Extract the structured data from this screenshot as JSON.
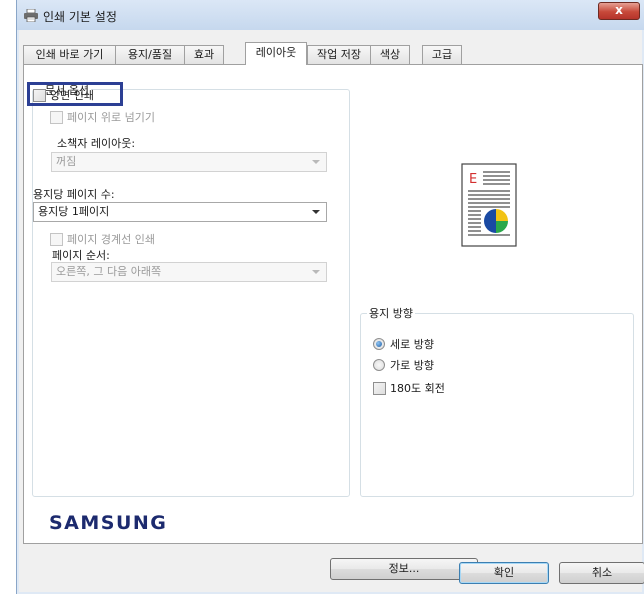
{
  "window": {
    "title": "인쇄 기본 설정",
    "close_label": "x"
  },
  "tabs": [
    {
      "label": "인쇄 바로 가기"
    },
    {
      "label": "용지/품질"
    },
    {
      "label": "효과"
    },
    {
      "label": "레이아웃"
    },
    {
      "label": "작업 저장"
    },
    {
      "label": "색상"
    },
    {
      "label": "고급"
    }
  ],
  "document_options": {
    "legend": "문서 옵션",
    "duplex_label": "양면 인쇄",
    "duplex_checked": false,
    "flip_pages_label": "페이지 위로 넘기기",
    "booklet_label": "소책자 레이아웃:",
    "booklet_value": "꺼짐",
    "pages_per_sheet_label": "용지당 페이지 수:",
    "pages_per_sheet_value": "용지당 1페이지",
    "print_borders_label": "페이지 경계선 인쇄",
    "page_order_label": "페이지 순서:",
    "page_order_value": "오른쪽, 그 다음 아래쪽"
  },
  "orientation": {
    "legend": "용지 방향",
    "portrait_label": "세로 방향",
    "landscape_label": "가로 방향",
    "rotate_label": "180도 회전",
    "selected": "portrait"
  },
  "brand": {
    "logo_text": "SAMSUNG"
  },
  "buttons": {
    "info_label": "정보...",
    "ok_label": "확인",
    "cancel_label": "취소"
  },
  "colors": {
    "highlight_box": "#2c3f94",
    "preview_letter": "#d32f2f",
    "logo": "#1c2a6e"
  }
}
